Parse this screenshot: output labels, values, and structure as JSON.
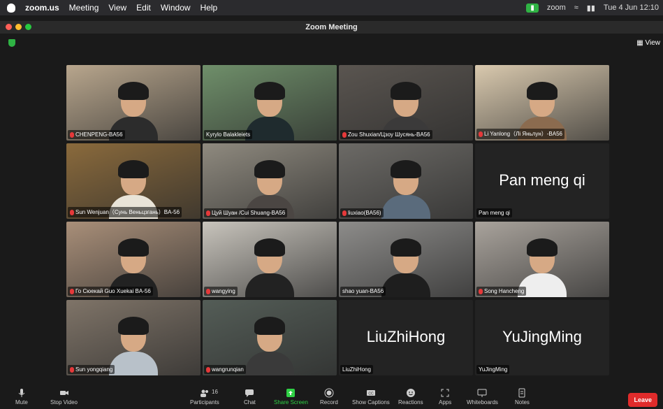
{
  "menubar": {
    "app": "zoom.us",
    "items": [
      "Meeting",
      "View",
      "Edit",
      "Window",
      "Help"
    ],
    "zoom_label": "zoom",
    "datetime": "Tue 4 Jun 12:10"
  },
  "window": {
    "title": "Zoom Meeting",
    "view_label": "View"
  },
  "participants": [
    {
      "name": "CHENPENG-BA56",
      "muted": true,
      "video": true,
      "bg": "#b8a68d",
      "shirt": "#2c2c2c"
    },
    {
      "name": "Kyrylo Balakleiets",
      "muted": false,
      "video": true,
      "bg": "#6f8f6a",
      "shirt": "#1f2b2e",
      "speaking": true
    },
    {
      "name": "Zou Shuxian/Цзоу Шусянь-BA56",
      "muted": true,
      "video": true,
      "bg": "#5a5550",
      "shirt": "#3b3a3a"
    },
    {
      "name": "Li Yanlong（Лі Яньлун）-BA56",
      "muted": true,
      "video": true,
      "bg": "#d9c9ae",
      "shirt": "#8b6b4f"
    },
    {
      "name": "Sun Wenjuan（Сунь Веньцзгань）BA-56",
      "muted": true,
      "video": true,
      "bg": "#8a6a3c",
      "shirt": "#e9e4d8"
    },
    {
      "name": "Цуй Шуан /Cui Shuang-BA56",
      "muted": true,
      "video": true,
      "bg": "#8f8a7f",
      "shirt": "#4b4643"
    },
    {
      "name": "liuxiao(BA56)",
      "muted": true,
      "video": true,
      "bg": "#6c6a66",
      "shirt": "#5a6b7c"
    },
    {
      "name": "Pan meng qi",
      "muted": false,
      "video": false,
      "display": "Pan meng qi"
    },
    {
      "name": "Го Сюекай Guo Xuekai BA-56",
      "muted": true,
      "video": true,
      "bg": "#a98f79",
      "shirt": "#222"
    },
    {
      "name": "wangying",
      "muted": true,
      "video": true,
      "bg": "#c8c4bc",
      "shirt": "#222"
    },
    {
      "name": "shao yuan-BA56",
      "muted": false,
      "video": true,
      "bg": "#8d8c8a",
      "shirt": "#1e1e1e"
    },
    {
      "name": "Song Hancheng",
      "muted": true,
      "video": true,
      "bg": "#a9a39c",
      "shirt": "#eee"
    },
    {
      "name": "Sun yongqiang",
      "muted": true,
      "video": true,
      "bg": "#7f7468",
      "shirt": "#b8c1c9"
    },
    {
      "name": "wangrunqian",
      "muted": true,
      "video": true,
      "bg": "#545d57",
      "shirt": "#3a3a3a"
    },
    {
      "name": "LiuZhiHong",
      "muted": false,
      "video": false,
      "display": "LiuZhiHong"
    },
    {
      "name": "YuJingMing",
      "muted": false,
      "video": false,
      "display": "YuJingMing"
    }
  ],
  "toolbar": {
    "mute": "Mute",
    "stop_video": "Stop Video",
    "participants": "Participants",
    "participants_count": "16",
    "chat": "Chat",
    "share_screen": "Share Screen",
    "record": "Record",
    "show_captions": "Show Captions",
    "reactions": "Reactions",
    "apps": "Apps",
    "whiteboards": "Whiteboards",
    "notes": "Notes",
    "leave": "Leave"
  },
  "colors": {
    "accent_green": "#2fd045",
    "leave_red": "#e02b2b",
    "mute_red": "#e5393a"
  }
}
